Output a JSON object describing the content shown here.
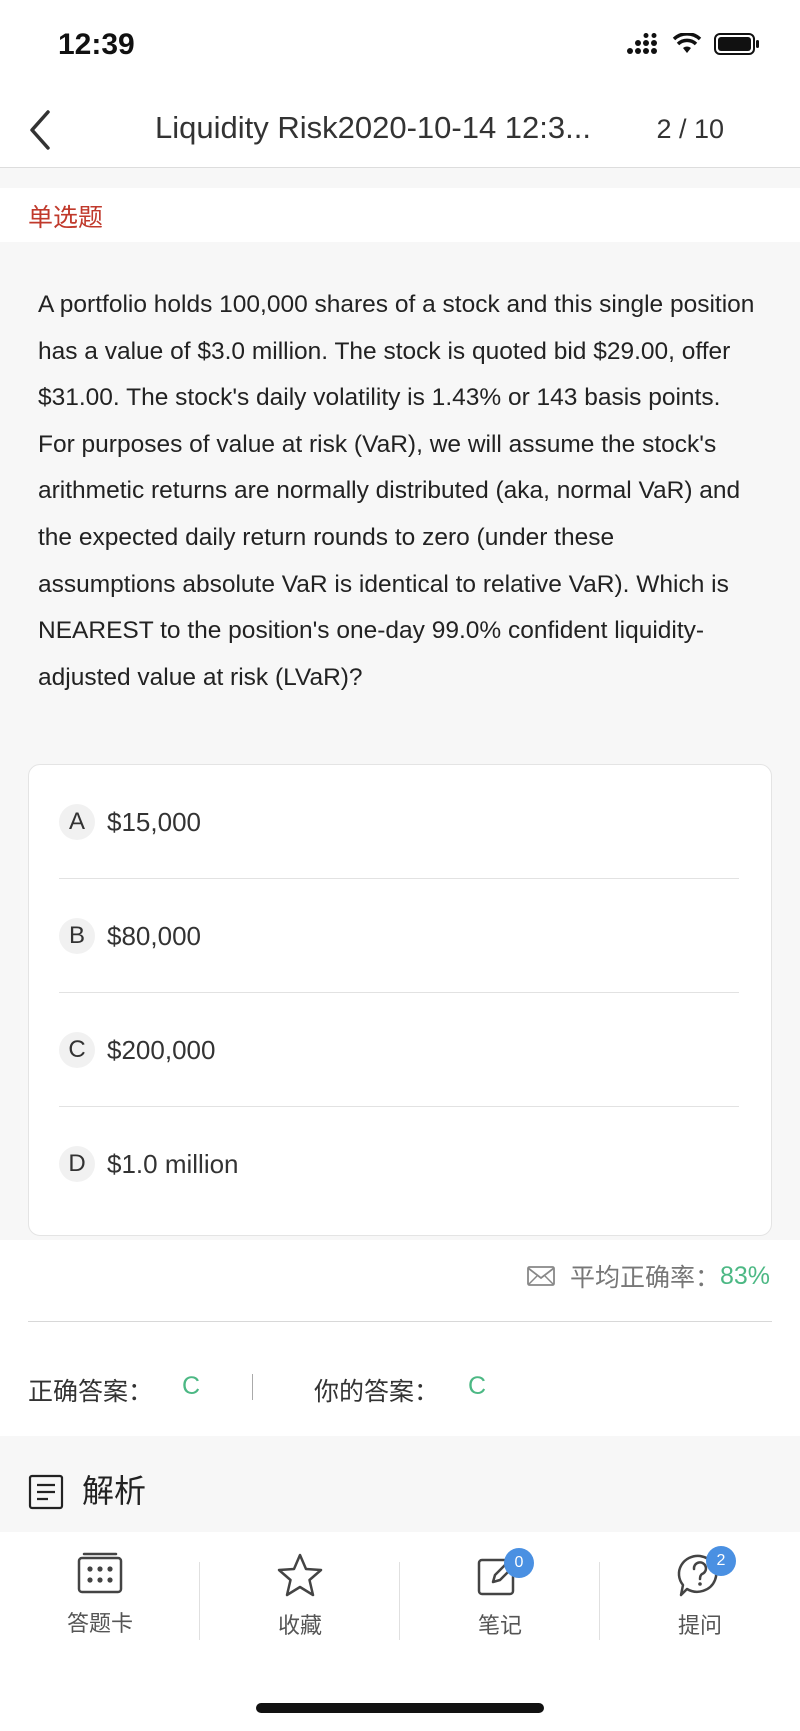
{
  "status": {
    "time": "12:39"
  },
  "nav": {
    "title": "Liquidity Risk2020-10-14 12:3...",
    "page": "2 / 10"
  },
  "question": {
    "type": "单选题",
    "text": "A portfolio holds 100,000 shares of a stock and this single position has a value of $3.0 million. The stock is quoted bid $29.00, offer $31.00. The stock's daily volatility is 1.43% or 143 basis points. For purposes of value at risk (VaR), we will assume the stock's arithmetic returns are normally distributed (aka, normal VaR) and the expected daily return rounds to zero (under these assumptions absolute VaR is identical to relative VaR). Which is NEAREST to the position's one-day 99.0% confident liquidity-adjusted value at risk (LVaR)?",
    "options": [
      {
        "letter": "A",
        "text": "$15,000"
      },
      {
        "letter": "B",
        "text": "$80,000"
      },
      {
        "letter": "C",
        "text": "$200,000"
      },
      {
        "letter": "D",
        "text": "$1.0 million"
      }
    ]
  },
  "stats": {
    "rate_label": "平均正确率：",
    "rate_value": "83%"
  },
  "answer": {
    "correct_label": "正确答案：",
    "correct_value": "C",
    "yours_label": "你的答案：",
    "yours_value": "C"
  },
  "analysis": {
    "title": "解析"
  },
  "toolbar": {
    "answer_card": "答题卡",
    "favorite": "收藏",
    "notes": "笔记",
    "notes_count": "0",
    "ask": "提问",
    "ask_count": "2"
  },
  "colors": {
    "accent": "#4cb884",
    "type_red": "#c0392b",
    "badge_blue": "#4a90e2"
  }
}
